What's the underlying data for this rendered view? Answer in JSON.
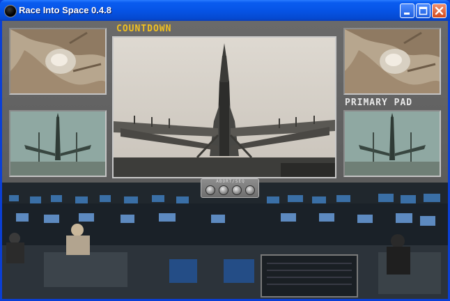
{
  "window": {
    "title": "Race Into Space 0.4.8",
    "buttons": [
      "minimize",
      "maximize",
      "close"
    ]
  },
  "labels": {
    "countdown": "COUNTDOWN",
    "pad": "PRIMARY PAD"
  },
  "control_module": {
    "label": "ABORT/SEQ",
    "knob_count": 4
  },
  "colors": {
    "countdown_label": "#f0c020",
    "pad_label": "#e8e8e8",
    "titlebar": "#0654e6",
    "console_gray": "#5c5c5c"
  },
  "icons": {
    "app": "planet-icon",
    "minimize": "minimize-icon",
    "maximize": "maximize-icon",
    "close": "close-icon"
  }
}
